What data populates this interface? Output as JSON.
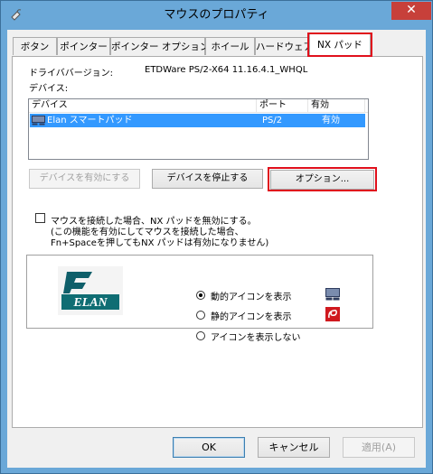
{
  "window": {
    "title": "マウスのプロパティ",
    "close_glyph": "✕",
    "accent_color": "#6aa8d8",
    "highlight_color": "#e0101c"
  },
  "tabs": [
    {
      "label": "ボタン",
      "active": false
    },
    {
      "label": "ポインター",
      "active": false
    },
    {
      "label": "ポインター オプション",
      "active": false
    },
    {
      "label": "ホイール",
      "active": false
    },
    {
      "label": "ハードウェア",
      "active": false
    },
    {
      "label": "NX パッド",
      "active": true
    }
  ],
  "driver": {
    "label": "ドライババージョン:",
    "value": "ETDWare PS/2-X64 11.16.4.1_WHQL"
  },
  "devices": {
    "label": "デバイス:",
    "columns": [
      "デバイス",
      "ポート",
      "有効"
    ],
    "rows": [
      {
        "name": "Elan スマートパッド",
        "port": "PS/2",
        "enabled": "有効",
        "selected": true
      }
    ]
  },
  "device_buttons": {
    "enable": "デバイスを有効にする",
    "disable": "デバイスを停止する",
    "options": "オプション..."
  },
  "disable_on_mouse": {
    "checked": false,
    "line1": "マウスを接続した場合、NX パッドを無効にする。",
    "line2": "(この機能を有効にしてマウスを接続した場合、",
    "line3": "Fn+Spaceを押してもNX パッドは有効になりません)"
  },
  "logo": {
    "text": "ELAN"
  },
  "icon_options": [
    {
      "label": "動的アイコンを表示",
      "selected": true,
      "icon": "touchpad-icon"
    },
    {
      "label": "静的アイコンを表示",
      "selected": false,
      "icon": "elan-tray-icon"
    },
    {
      "label": "アイコンを表示しない",
      "selected": false
    }
  ],
  "footer": {
    "ok": "OK",
    "cancel": "キャンセル",
    "apply": "適用(A)"
  }
}
